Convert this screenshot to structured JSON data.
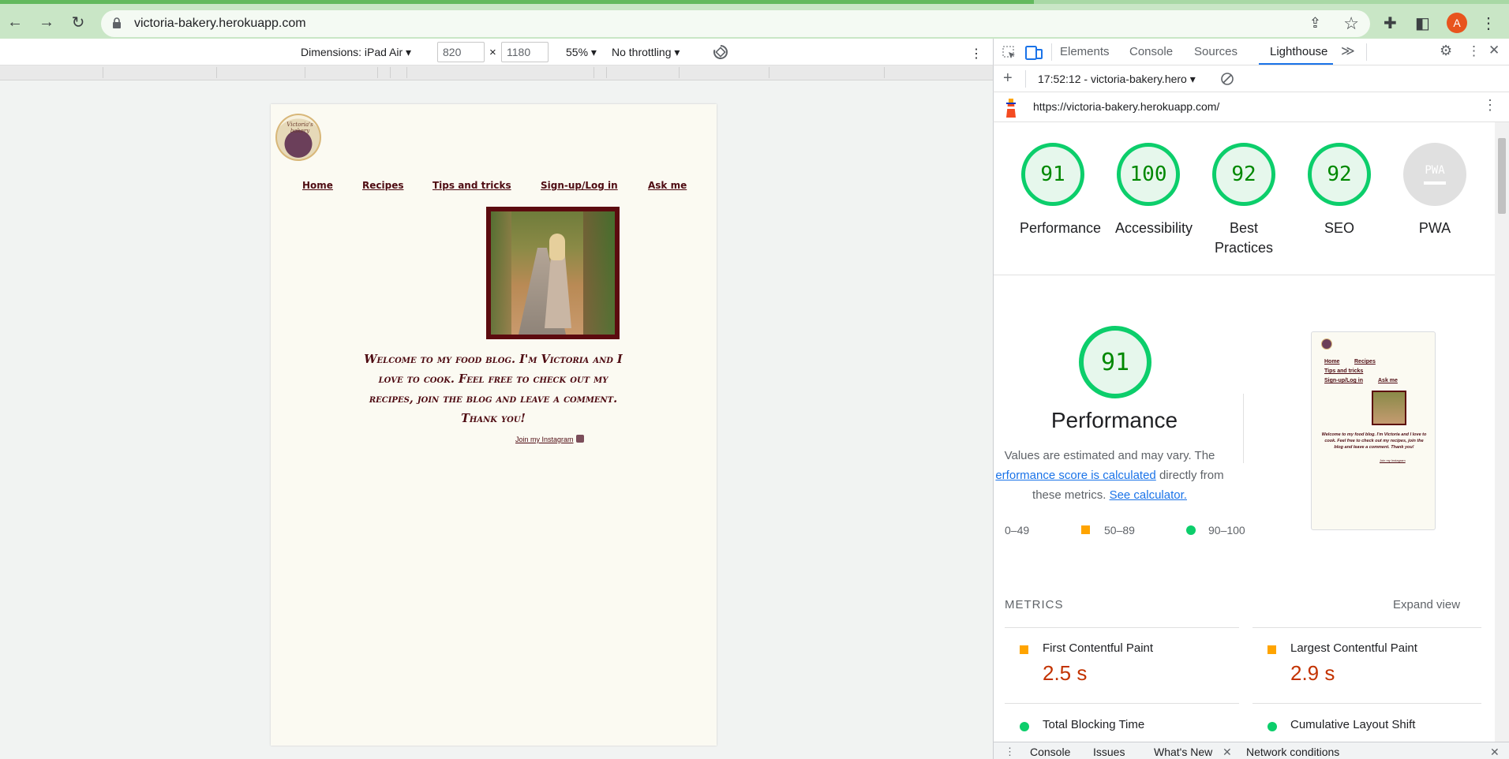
{
  "browser": {
    "url": "victoria-bakery.herokuapp.com",
    "progress": 0.685,
    "avatar_letter": "A",
    "icons": [
      "back-icon",
      "forward-icon",
      "reload-icon",
      "lock-icon",
      "share-icon",
      "star-icon",
      "extensions-icon",
      "sidepanel-icon",
      "menu-icon"
    ]
  },
  "device_toolbar": {
    "dimensions_label": "Dimensions: iPad Air ▾",
    "width": "820",
    "times": "×",
    "height": "1180",
    "zoom": "55% ▾",
    "throttling": "No throttling ▾",
    "more": "⋮"
  },
  "site": {
    "logo_text": "Victoria's bakery",
    "nav": [
      "Home",
      "Recipes",
      "Tips and tricks",
      "Sign-up/Log in",
      "Ask me"
    ],
    "welcome": "Welcome to my food blog. I'm Victoria and I love to cook. Feel free to check out my recipes, join the blog and leave a comment. Thank you!",
    "instagram_link": "Join my Instagram"
  },
  "devtools": {
    "tabs": [
      "Elements",
      "Console",
      "Sources",
      "Lighthouse"
    ],
    "active_tab": "Lighthouse",
    "more_tabs": "≫",
    "report_selector": "17:52:12 - victoria-bakery.hero ▾",
    "report_url": "https://victoria-bakery.herokuapp.com/",
    "scores": [
      {
        "label": "Performance",
        "value": "91"
      },
      {
        "label": "Accessibility",
        "value": "100"
      },
      {
        "label": "Best Practices",
        "value": "92"
      },
      {
        "label": "SEO",
        "value": "92"
      },
      {
        "label": "PWA",
        "value": "PWA"
      }
    ],
    "performance": {
      "score": "91",
      "title": "Performance",
      "desc_part1": "Values are estimated and may vary. The",
      "desc_link1": "erformance score is calculated",
      "desc_part2": " directly from these metrics. ",
      "desc_link2": "See calculator."
    },
    "legend": [
      "0–49",
      "50–89",
      "90–100"
    ],
    "thumbnail": {
      "nav": [
        "Home",
        "Recipes",
        "Tips and tricks",
        "Sign-up/Log in",
        "Ask me"
      ],
      "text": "Welcome to my food blog. I'm Victoria and I love to cook. Feel free to check out my recipes, join the blog and leave a comment. Thank you!",
      "insta": "Join my Instagram"
    },
    "metrics_header": "METRICS",
    "expand_view": "Expand view",
    "metrics": [
      {
        "name": "First Contentful Paint",
        "value": "2.5 s",
        "status": "average"
      },
      {
        "name": "Largest Contentful Paint",
        "value": "2.9 s",
        "status": "average"
      },
      {
        "name": "Total Blocking Time",
        "value": "",
        "status": "pass"
      },
      {
        "name": "Cumulative Layout Shift",
        "value": "",
        "status": "pass"
      }
    ],
    "drawer_tabs": [
      "Console",
      "Issues",
      "What's New",
      "Network conditions"
    ],
    "colors": {
      "pass": "#0cce6b",
      "average": "#ffa400",
      "fail": "#ff4e42",
      "accent": "#1a73e8"
    }
  }
}
